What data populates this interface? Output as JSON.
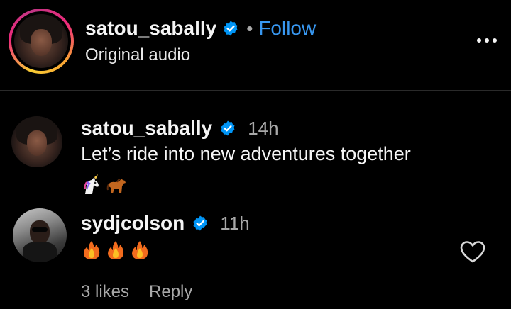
{
  "header": {
    "username": "satou_sabally",
    "separator": "•",
    "follow_label": "Follow",
    "subtitle": "Original audio"
  },
  "comments": [
    {
      "username": "satou_sabally",
      "timestamp": "14h",
      "text": "Let’s ride into new adventures together",
      "emoji": [
        "unicorn-emoji",
        "horse-emoji"
      ]
    },
    {
      "username": "sydjcolson",
      "timestamp": "11h",
      "text": "",
      "emoji": [
        "fire-emoji",
        "fire-emoji",
        "fire-emoji"
      ],
      "likes_label": "3 likes",
      "reply_label": "Reply"
    }
  ],
  "colors": {
    "background": "#000000",
    "follow_blue": "#3897f0",
    "verified_blue": "#0095f6",
    "muted_text": "#a8a8a8"
  }
}
